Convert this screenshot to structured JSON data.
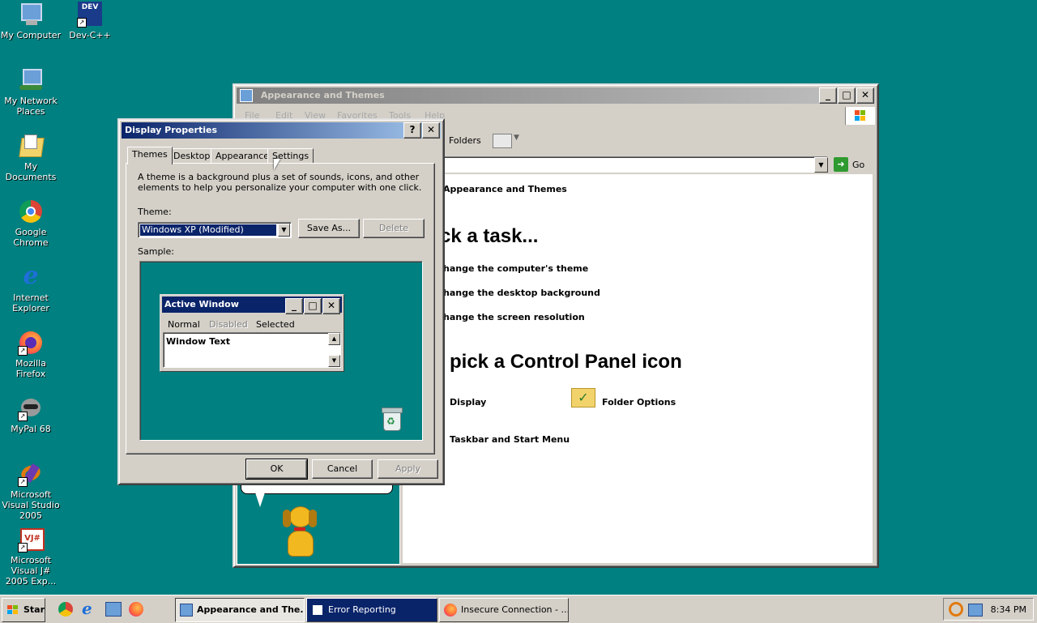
{
  "desktop_icons": [
    {
      "label": "My Computer"
    },
    {
      "label": "Dev-C++",
      "badge": "DEV"
    },
    {
      "label": "My Network Places"
    },
    {
      "label": "My Documents"
    },
    {
      "label": "Google Chrome"
    },
    {
      "label": "Internet Explorer"
    },
    {
      "label": "Mozilla Firefox"
    },
    {
      "label": "MyPal 68"
    },
    {
      "label": "Microsoft Visual Studio 2005"
    },
    {
      "label": "Microsoft Visual J# 2005 Exp...",
      "badge": "VJ#"
    }
  ],
  "explorer": {
    "title": "Appearance and Themes",
    "menu": [
      "File",
      "Edit",
      "View",
      "Favorites",
      "Tools",
      "Help"
    ],
    "toolbar": {
      "folders": "Folders"
    },
    "address": {
      "go": "Go"
    },
    "section_title": "Appearance and Themes",
    "pick_task": "ck a task...",
    "tasks": [
      "hange the computer's theme",
      "hange the desktop background",
      "hange the screen resolution"
    ],
    "pick_icon": "pick a Control Panel icon",
    "icons": [
      "Display",
      "Folder Options",
      "Taskbar and Start Menu"
    ]
  },
  "dialog": {
    "title": "Display Properties",
    "tabs": [
      "Themes",
      "Desktop",
      "Appearance",
      "Settings"
    ],
    "description": "A theme is a background plus a set of sounds, icons, and other elements to help you personalize your computer with one click.",
    "theme_label": "Theme:",
    "theme_value": "Windows XP (Modified)",
    "save_as": "Save As...",
    "delete": "Delete",
    "sample_label": "Sample:",
    "sample": {
      "title": "Active Window",
      "menu": [
        "Normal",
        "Disabled",
        "Selected"
      ],
      "text": "Window Text"
    },
    "ok": "OK",
    "cancel": "Cancel",
    "apply": "Apply"
  },
  "taskbar": {
    "start": "Start",
    "tasks": [
      "Appearance and The...",
      "Error Reporting",
      "Insecure Connection - ..."
    ],
    "clock": "8:34 PM"
  },
  "colors": {
    "desktop": "#008080",
    "titlebar": "#0a246a",
    "face": "#d4d0c8"
  }
}
